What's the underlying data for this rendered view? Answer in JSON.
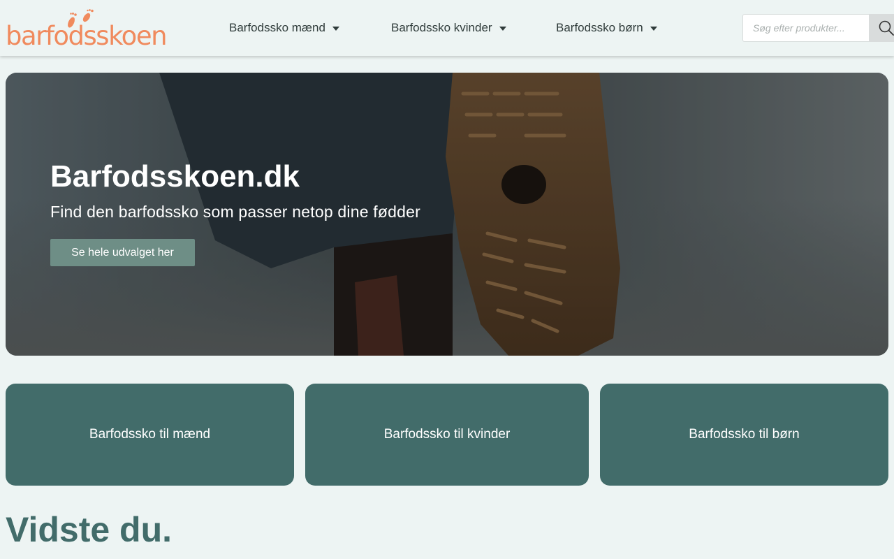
{
  "brand": {
    "logo_text": "barfodsskoen",
    "logo_color": "#f08a5d"
  },
  "nav": {
    "items": [
      {
        "label": "Barfodssko mænd"
      },
      {
        "label": "Barfodssko kvinder"
      },
      {
        "label": "Barfodssko børn"
      }
    ]
  },
  "search": {
    "placeholder": "Søg efter produkter...",
    "value": "",
    "button_icon": "search-icon"
  },
  "hero": {
    "title": "Barfodsskoen.dk",
    "subtitle": "Find den barfodssko som passer netop dine fødder",
    "button_label": "Se hele udvalget her",
    "button_color": "#6e8e86"
  },
  "categories": [
    {
      "label": "Barfodssko til mænd"
    },
    {
      "label": "Barfodssko til kvinder"
    },
    {
      "label": "Barfodssko til børn"
    }
  ],
  "section": {
    "heading": "Vidste du."
  },
  "colors": {
    "background": "#edf4f3",
    "card": "#426c6a",
    "accent": "#f08a5d"
  }
}
